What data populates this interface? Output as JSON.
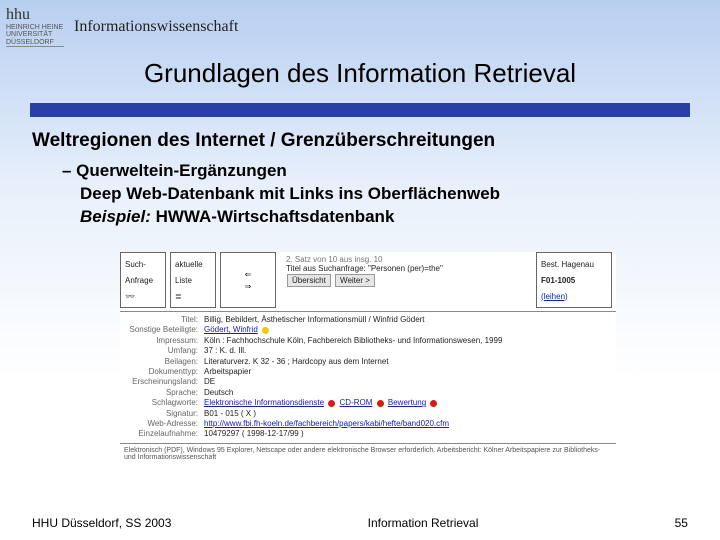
{
  "header": {
    "uni_line1": "HEINRICH HEINE",
    "uni_line2": "UNIVERSITÄT",
    "uni_line3": "DÜSSELDORF",
    "signature": "hhu",
    "department": "Informationswissenschaft"
  },
  "slide": {
    "title": "Grundlagen des Information Retrieval",
    "subtitle": "Weltregionen des Internet / Grenzüberschreitungen",
    "bullet_label": "– Querweltein-Ergänzungen",
    "bullet_line2": "Deep Web-Datenbank mit Links ins Oberflächenweb",
    "bullet_example_prefix": "Beispiel:",
    "bullet_example_value": "HWWA-Wirtschaftsdatenbank"
  },
  "figure": {
    "nav_box1_l1": "Such-",
    "nav_box1_l2": "Anfrage",
    "nav_box2_l1": "aktuelle",
    "nav_box2_l2": "Liste",
    "status": "2. Satz von 10 aus insg. 10",
    "query_label": "Titel aus Suchanfrage: \"Personen (per)=the\"",
    "btn_prev": "Übersicht",
    "btn_next": "Weiter >",
    "stand_label": "Best. Hagenau",
    "stand_sig": "F01-1005",
    "stand_link": "(leihen)",
    "record": {
      "titel_label": "Titel:",
      "titel": "Billig, Bebildert, Ästhetischer Informationsmüll / Winfrid Gödert",
      "sonstige_label": "Sonstige Beteiligte:",
      "sonstige": "Gödert, Winfrid",
      "impressum_label": "Impressum:",
      "impressum": "Köln : Fachhochschule Köln, Fachbereich Bibliotheks- und Informationswesen, 1999",
      "umfang_label": "Umfang:",
      "umfang": "37 : K. d. Ill.",
      "beilagen_label": "Beilagen:",
      "beilagen": "Literaturverz. K 32 - 36 ; Hardcopy aus dem Internet",
      "dokumenttyp_label": "Dokumenttyp:",
      "dokumenttyp": "Arbeitspapier",
      "erscheinungsland_label": "Erscheinungsland:",
      "erscheinungsland": "DE",
      "sprache_label": "Sprache:",
      "sprache": "Deutsch",
      "schlagworte_label": "Schlagworte:",
      "schlagworte": [
        "Elektronische Informationsdienste",
        "CD-ROM",
        "Bewertung"
      ],
      "signatur_label": "Signatur:",
      "signatur": "B01 - 015 ( X )",
      "web_label": "Web-Adresse:",
      "web": "http://www.fbi.fh-koeln.de/fachbereich/papers/kabi/hefte/band020.cfm",
      "einzel_label": "Einzelaufnahme:",
      "einzel": "10479297 ( 1998-12-17/99 )"
    },
    "footnote": "Elektronisch (PDF), Windows 95 Explorer, Netscape oder andere elektronische Browser erforderlich. Arbeitsbericht: Kölner Arbeitspapiere zur Bibliotheks- und Informationswissenschaft"
  },
  "footer": {
    "left": "HHU Düsseldorf, SS 2003",
    "center": "Information Retrieval",
    "page": "55"
  }
}
